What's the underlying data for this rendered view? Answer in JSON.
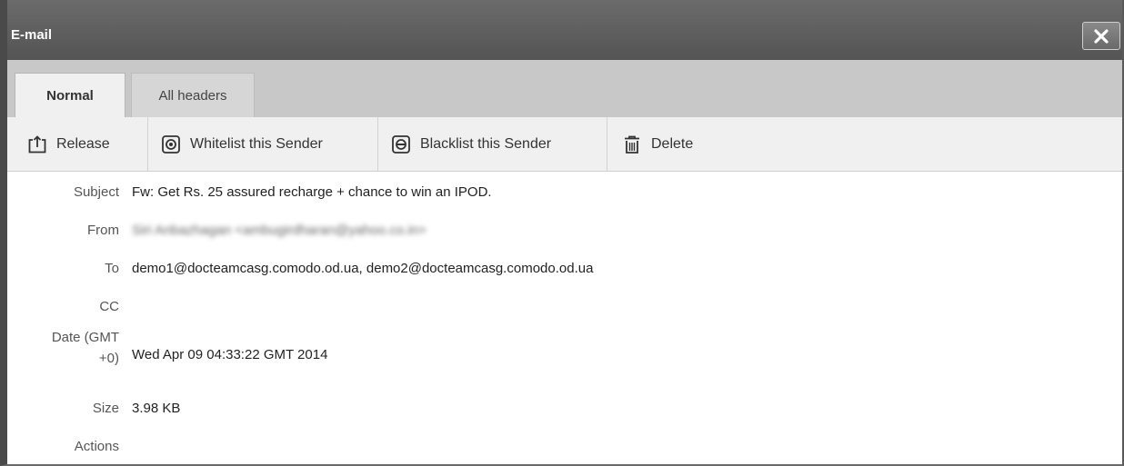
{
  "window": {
    "title": "E-mail",
    "close_icon": "close-icon"
  },
  "tabs": [
    {
      "label": "Normal",
      "active": true
    },
    {
      "label": "All headers",
      "active": false
    }
  ],
  "toolbar": {
    "release": {
      "label": "Release",
      "icon": "release-icon"
    },
    "whitelist": {
      "label": "Whitelist this Sender",
      "icon": "whitelist-icon"
    },
    "blacklist": {
      "label": "Blacklist this Sender",
      "icon": "blacklist-icon"
    },
    "delete": {
      "label": "Delete",
      "icon": "trash-icon"
    }
  },
  "details": {
    "subject": {
      "label": "Subject",
      "value": "Fw: Get Rs. 25 assured recharge + chance to win an IPOD."
    },
    "from": {
      "label": "From",
      "value": "Siri Anbazhagan <ambugirdharan@yahoo.co.in>"
    },
    "to": {
      "label": "To",
      "value": "demo1@docteamcasg.comodo.od.ua, demo2@docteamcasg.comodo.od.ua"
    },
    "cc": {
      "label": "CC",
      "value": ""
    },
    "date": {
      "label_line1": "Date (GMT",
      "label_line2": "+0)",
      "value": "Wed Apr 09 04:33:22 GMT 2014"
    },
    "size": {
      "label": "Size",
      "value": "3.98 KB"
    },
    "actions": {
      "label": "Actions",
      "value": ""
    }
  },
  "colors": {
    "titlebar": "#5e5e5e",
    "tabbar": "#c8c8c8",
    "toolbar": "#f0f0f0"
  }
}
